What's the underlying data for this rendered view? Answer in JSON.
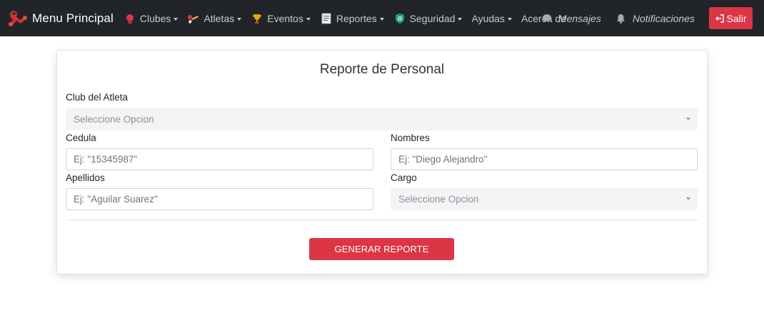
{
  "navbar": {
    "brand": "Menu Principal",
    "items": [
      {
        "label": "Clubes",
        "icon": "boxing-glove-icon"
      },
      {
        "label": "Atletas",
        "icon": "athlete-icon"
      },
      {
        "label": "Eventos",
        "icon": "trophy-icon"
      },
      {
        "label": "Reportes",
        "icon": "report-document-icon"
      },
      {
        "label": "Seguridad",
        "icon": "shield-icon"
      },
      {
        "label": "Ayudas",
        "icon": ""
      },
      {
        "label": "Acerca de",
        "icon": ""
      }
    ],
    "mensajes": "Mensajes",
    "notificaciones": "Notificaciones",
    "salir": "Salir",
    "colors": {
      "bg": "#212529",
      "danger": "#dc3545"
    }
  },
  "form": {
    "title": "Reporte de Personal",
    "club_label": "Club del Atleta",
    "club_value": "Seleccione Opcion",
    "cedula_label": "Cedula",
    "cedula_placeholder": "Ej: \"15345987\"",
    "nombres_label": "Nombres",
    "nombres_placeholder": "Ej: \"Diego Alejandro\"",
    "apellidos_label": "Apellidos",
    "apellidos_placeholder": "Ej: \"Aguilar Suarez\"",
    "cargo_label": "Cargo",
    "cargo_value": "Seleccione Opcion",
    "generate_button": "GENERAR REPORTE"
  }
}
